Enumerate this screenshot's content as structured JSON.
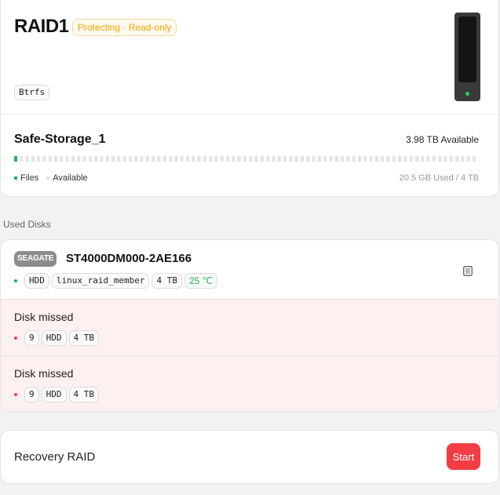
{
  "raid": {
    "title": "RAID1",
    "status": "Protecting · Read-only",
    "filesystem": "Btrfs"
  },
  "storage": {
    "name": "Safe-Storage_1",
    "available": "3.98 TB Available",
    "usage_text": "20.5 GB Used / 4 TB",
    "used_fraction": 0.005,
    "legend": {
      "files": "Files",
      "available": "Available"
    }
  },
  "used_disks": {
    "section_title": "Used Disks",
    "main_disk": {
      "brand": "SEAGATE",
      "model": "ST4000DM000-2AE166",
      "type": "HDD",
      "fs_type": "linux_raid_member",
      "size": "4 TB",
      "temperature": "25 ℃"
    },
    "missed": [
      {
        "title": "Disk missed",
        "slot": "9",
        "type": "HDD",
        "size": "4 TB"
      },
      {
        "title": "Disk missed",
        "slot": "9",
        "type": "HDD",
        "size": "4 TB"
      }
    ]
  },
  "recovery": {
    "label": "Recovery RAID",
    "button": "Start"
  },
  "colors": {
    "status_text": "#f0a400",
    "ok_green": "#22b24c",
    "error_red": "#f23d45",
    "missed_bg": "#fdf0f0"
  },
  "icons": [
    "nas-device-icon",
    "details-icon"
  ]
}
